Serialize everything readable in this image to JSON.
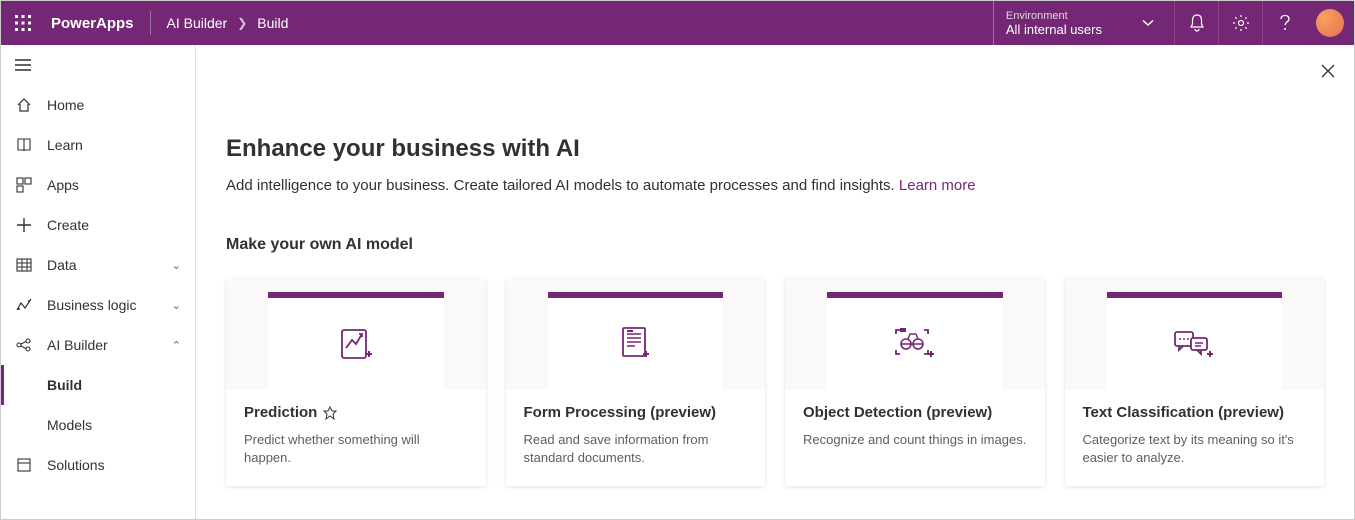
{
  "header": {
    "app_name": "PowerApps",
    "breadcrumb": [
      "AI Builder",
      "Build"
    ],
    "environment_label": "Environment",
    "environment_name": "All internal users"
  },
  "sidebar": {
    "items": [
      {
        "label": "Home"
      },
      {
        "label": "Learn"
      },
      {
        "label": "Apps"
      },
      {
        "label": "Create"
      },
      {
        "label": "Data"
      },
      {
        "label": "Business logic"
      },
      {
        "label": "AI Builder"
      },
      {
        "label": "Solutions"
      }
    ],
    "ai_builder_children": [
      {
        "label": "Build"
      },
      {
        "label": "Models"
      }
    ]
  },
  "main": {
    "title": "Enhance your business with AI",
    "subtitle_prefix": "Add intelligence to your business. Create tailored AI models to automate processes and find insights. ",
    "learn_more": "Learn more",
    "section_title": "Make your own AI model",
    "cards": [
      {
        "title": "Prediction",
        "premium": true,
        "desc": "Predict whether something will happen."
      },
      {
        "title": "Form Processing (preview)",
        "desc": "Read and save information from standard documents."
      },
      {
        "title": "Object Detection (preview)",
        "desc": "Recognize and count things in images."
      },
      {
        "title": "Text Classification (preview)",
        "desc": "Categorize text by its meaning so it's easier to analyze."
      }
    ]
  }
}
